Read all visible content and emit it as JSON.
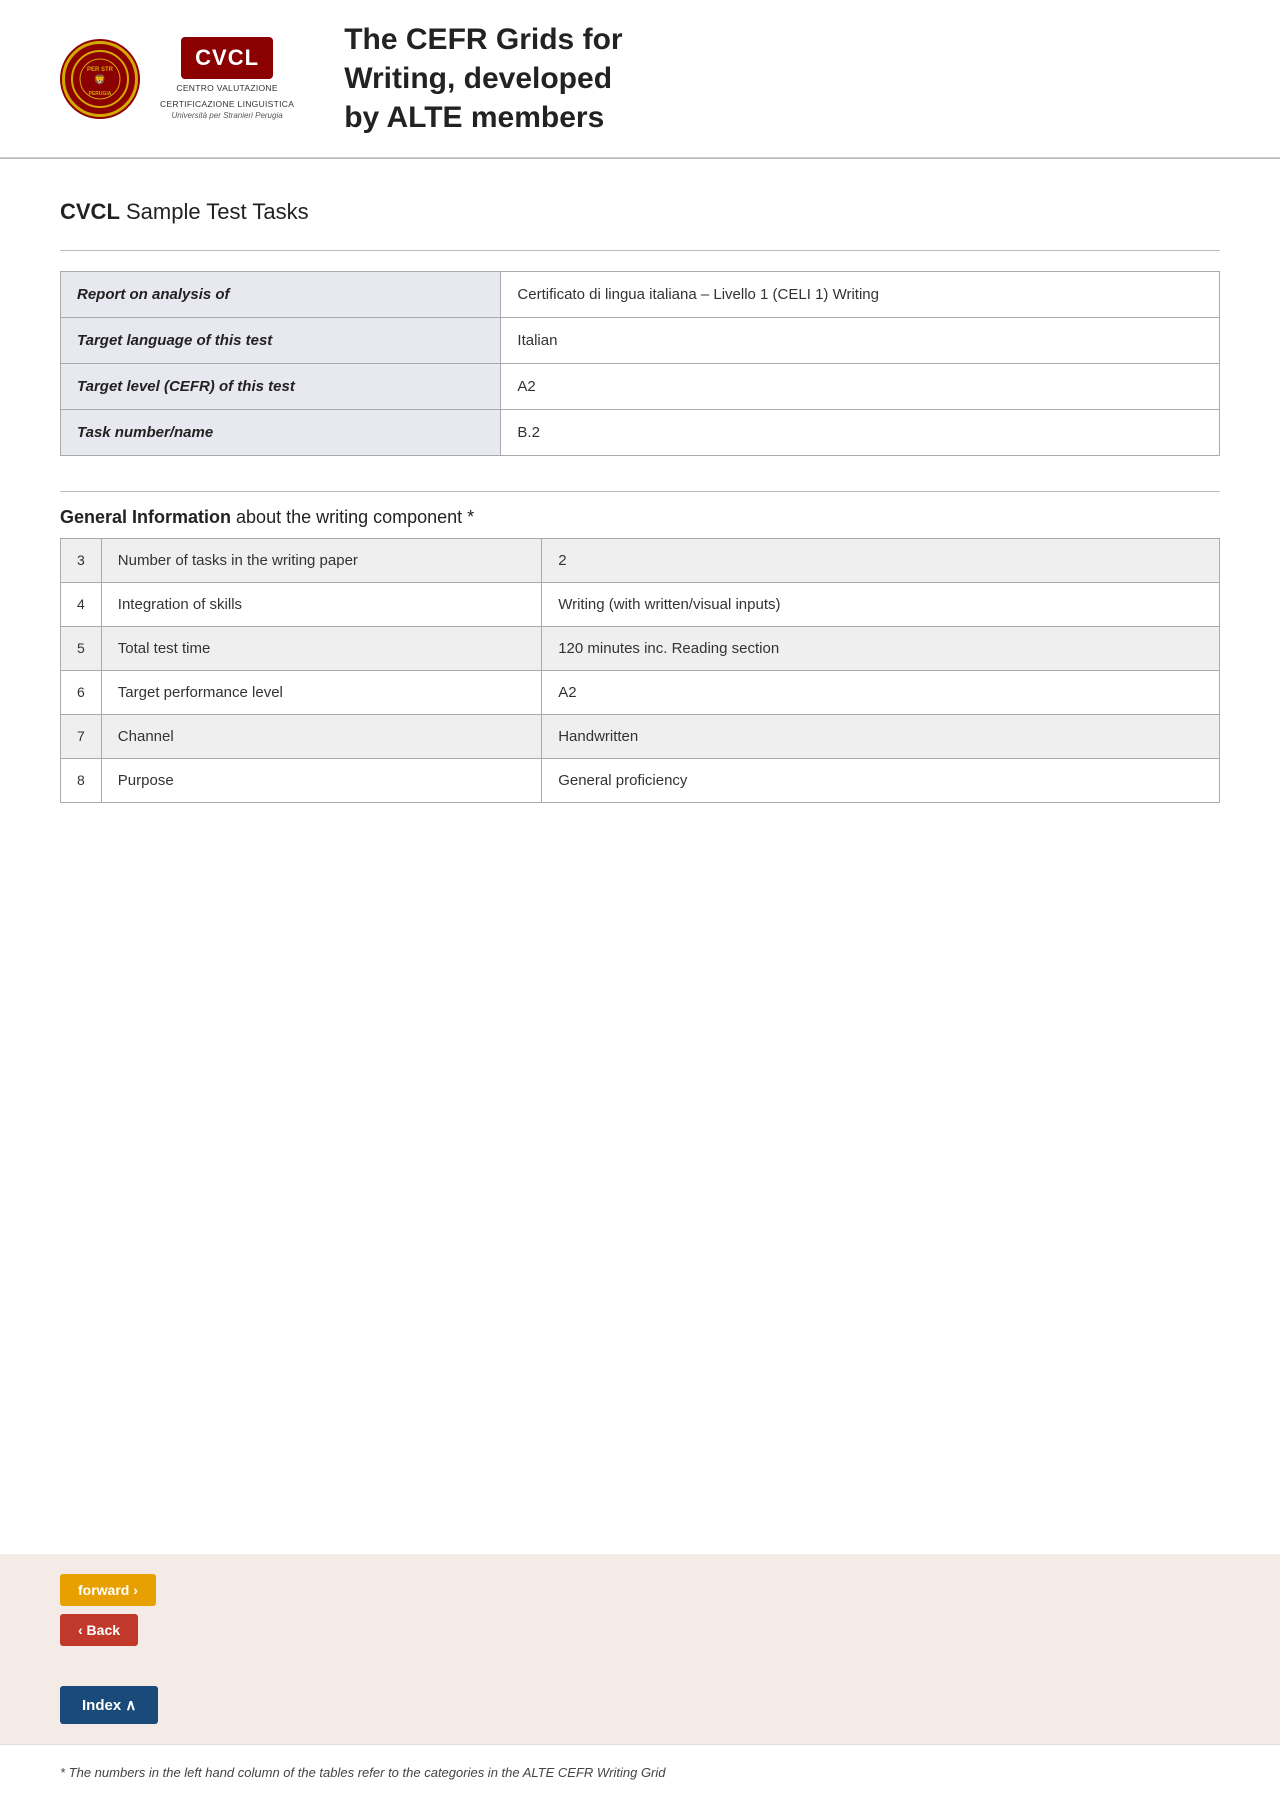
{
  "header": {
    "logo_cvcl_label": "CVCL",
    "logo_org_line1": "CENTRO VALUTAZIONE",
    "logo_org_line2": "CERTIFICAZIONE LINGUISTICA",
    "logo_org_sub": "Università per Stranieri Perugia",
    "title_line1": "The CEFR Grids for",
    "title_line2": "Writing, developed",
    "title_line3": "by ALTE members"
  },
  "section_title": {
    "prefix": "CVCL",
    "suffix": " Sample Test Tasks"
  },
  "info_table": {
    "rows": [
      {
        "label": "Report on analysis of",
        "value": "Certificato di lingua italiana – Livello 1 (CELI 1)  Writing"
      },
      {
        "label": "Target language of this test",
        "value": "Italian"
      },
      {
        "label": "Target level (CEFR) of this test",
        "value": "A2"
      },
      {
        "label": "Task number/name",
        "value": "B.2"
      }
    ]
  },
  "general_info": {
    "heading_bold": "General Information",
    "heading_rest": " about the writing component *",
    "rows": [
      {
        "num": "3",
        "label": "Number of tasks in the writing paper",
        "value": "2"
      },
      {
        "num": "4",
        "label": "Integration of skills",
        "value": "Writing (with written/visual inputs)"
      },
      {
        "num": "5",
        "label": "Total test time",
        "value": "120 minutes inc. Reading section"
      },
      {
        "num": "6",
        "label": "Target performance level",
        "value": "A2"
      },
      {
        "num": "7",
        "label": "Channel",
        "value": "Handwritten"
      },
      {
        "num": "8",
        "label": "Purpose",
        "value": "General proficiency"
      }
    ]
  },
  "buttons": {
    "forward_label": "forward ›",
    "back_label": "‹ Back",
    "index_label": "Index ∧"
  },
  "footer": {
    "note": "* The numbers in the left hand column of the tables refer to the categories in the ALTE CEFR Writing Grid"
  }
}
